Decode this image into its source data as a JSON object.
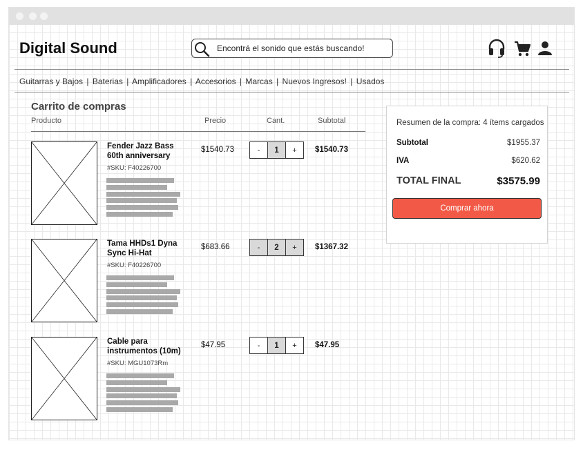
{
  "header": {
    "brand": "Digital Sound",
    "search_placeholder": "Encontrá el sonido que estás buscando!",
    "icons": [
      "headset-icon",
      "cart-icon",
      "user-icon"
    ]
  },
  "nav": {
    "items": [
      "Guitarras y Bajos",
      "Baterias",
      "Amplificadores",
      "Accesorios",
      "Marcas",
      "Nuevos Ingresos!",
      "Usados"
    ],
    "separator": "|"
  },
  "cart": {
    "title": "Carrito de compras",
    "columns": {
      "product": "Producto",
      "price": "Precio",
      "qty": "Cant.",
      "subtotal": "Subtotal"
    },
    "items": [
      {
        "name": "Fender Jazz Bass 60th anniversary",
        "sku": "#SKU: F40226700",
        "price": "$1540.73",
        "qty": "1",
        "subtotal": "$1540.73"
      },
      {
        "name": "Tama HHDs1 Dyna Sync Hi-Hat",
        "sku": "#SKU: F40226700",
        "price": "$683.66",
        "qty": "2",
        "subtotal": "$1367.32"
      },
      {
        "name": "Cable para instrumentos (10m)",
        "sku": "#SKU: MGU1073Rm",
        "price": "$47.95",
        "qty": "1",
        "subtotal": "$47.95"
      }
    ],
    "qty_minus": "-",
    "qty_plus": "+"
  },
  "summary": {
    "title": "Resumen de la compra: 4 ítems cargados",
    "subtotal_label": "Subtotal",
    "subtotal_value": "$1955.37",
    "iva_label": "IVA",
    "iva_value": "$620.62",
    "total_label": "TOTAL FINAL",
    "total_value": "$3575.99",
    "buy_label": "Comprar ahora"
  },
  "colors": {
    "accent": "#f25a47",
    "placeholder_line": "#a9a9a9",
    "qty_shade": "#d9d9d9"
  }
}
